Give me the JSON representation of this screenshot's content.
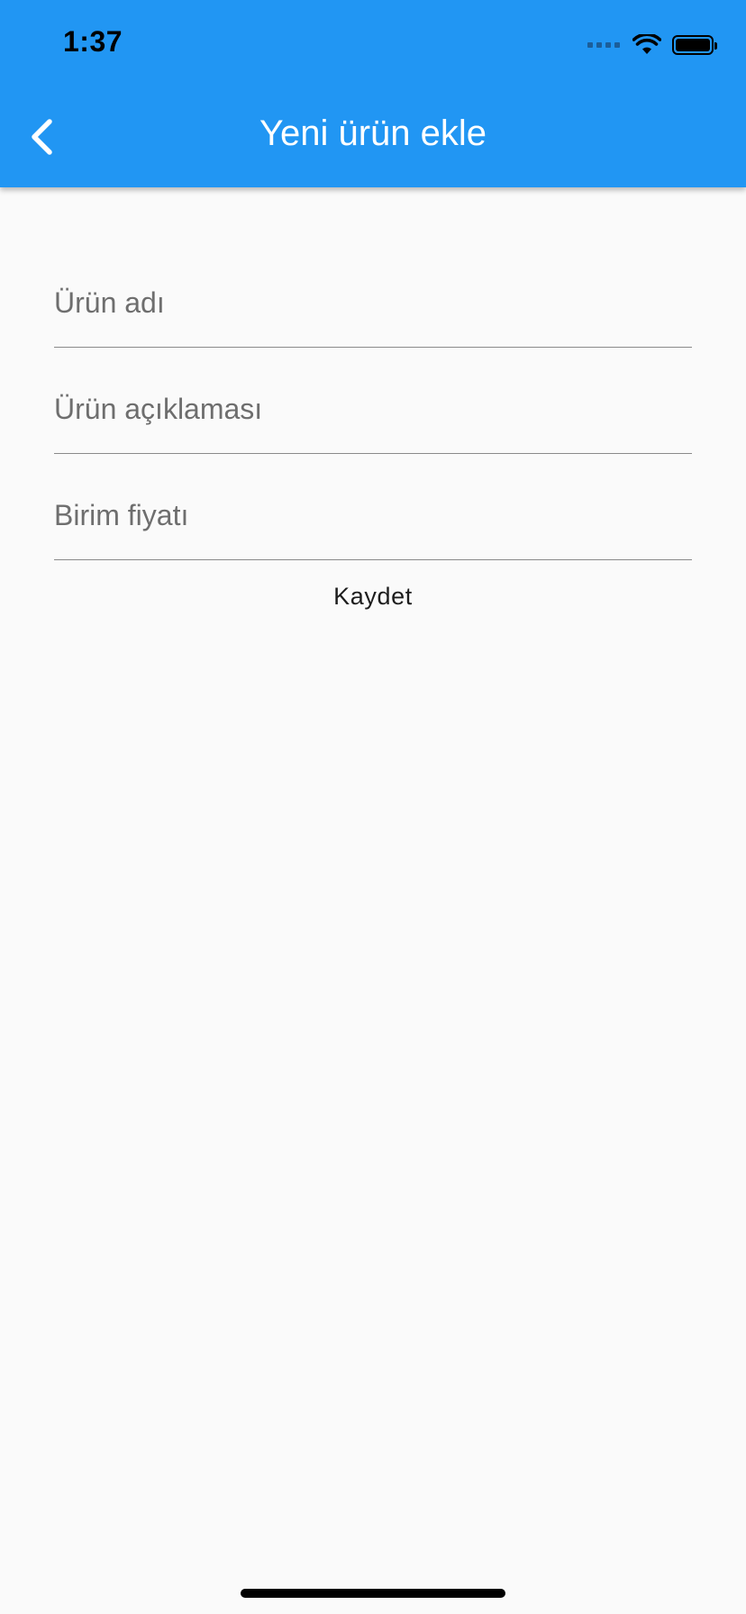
{
  "status_bar": {
    "time": "1:37",
    "icons": [
      "cellular-signal-icon",
      "wifi-icon",
      "battery-icon"
    ]
  },
  "app_bar": {
    "title": "Yeni ürün ekle",
    "back_icon": "chevron-left-icon",
    "background_color": "#2196f3",
    "title_color": "#ffffff"
  },
  "form": {
    "fields": [
      {
        "placeholder": "Ürün adı",
        "value": ""
      },
      {
        "placeholder": "Ürün açıklaması",
        "value": ""
      },
      {
        "placeholder": "Birim fiyatı",
        "value": ""
      }
    ],
    "save_label": "Kaydet"
  },
  "colors": {
    "page_background": "#fafafa",
    "divider": "#8a8a8a",
    "placeholder": "#6e6e6e"
  }
}
